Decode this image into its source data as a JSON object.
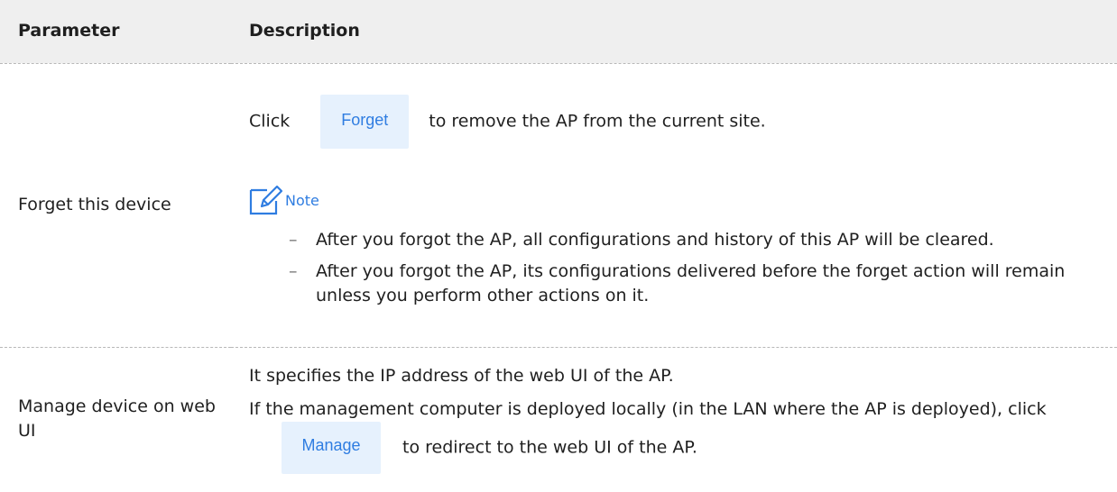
{
  "table": {
    "headers": {
      "parameter": "Parameter",
      "description": "Description"
    },
    "rows": [
      {
        "parameter": "Forget this device",
        "intro_before": "Click",
        "button": "Forget",
        "intro_after": "to remove the AP from the current site.",
        "note_title": "Note",
        "note_items": [
          "After you forgot the AP, all configurations and history of this AP will be cleared.",
          "After you forgot the AP, its configurations delivered before the forget action will remain unless you perform other actions on it."
        ]
      },
      {
        "parameter": "Manage device on web UI",
        "line1": "It specifies the IP address of the web UI of the AP.",
        "line2_before": "If the management computer is deployed locally (in the LAN where the AP is deployed), click",
        "button": "Manage",
        "line2_after": "to redirect to the web UI of the AP."
      }
    ]
  },
  "colors": {
    "accent": "#2f7de1",
    "button_bg": "#e6f1fd",
    "header_bg": "#efefef"
  },
  "icons": {
    "note": "note-pencil-icon",
    "list_marker": "dash"
  }
}
